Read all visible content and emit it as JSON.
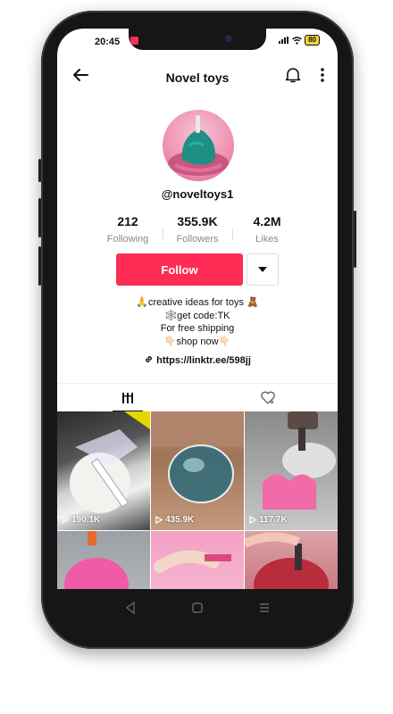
{
  "status": {
    "time": "20:45",
    "battery": "80"
  },
  "header": {
    "title": "Novel toys"
  },
  "profile": {
    "username": "@noveltoys1"
  },
  "stats": [
    {
      "value": "212",
      "label": "Following"
    },
    {
      "value": "355.9K",
      "label": "Followers"
    },
    {
      "value": "4.2M",
      "label": "Likes"
    }
  ],
  "actions": {
    "follow_label": "Follow"
  },
  "bio": {
    "line1": "🙏creative ideas for toys 🧸",
    "line2": "🕸️get code:TK",
    "line3": "For free shipping",
    "line4": "👇🏻shop now👇🏻",
    "link": "https://linktr.ee/598jj"
  },
  "videos": [
    {
      "views": "190.1K"
    },
    {
      "views": "435.9K"
    },
    {
      "views": "117.7K"
    },
    {
      "views": ""
    },
    {
      "views": ""
    },
    {
      "views": ""
    }
  ],
  "colors": {
    "accent": "#fe2c55"
  }
}
